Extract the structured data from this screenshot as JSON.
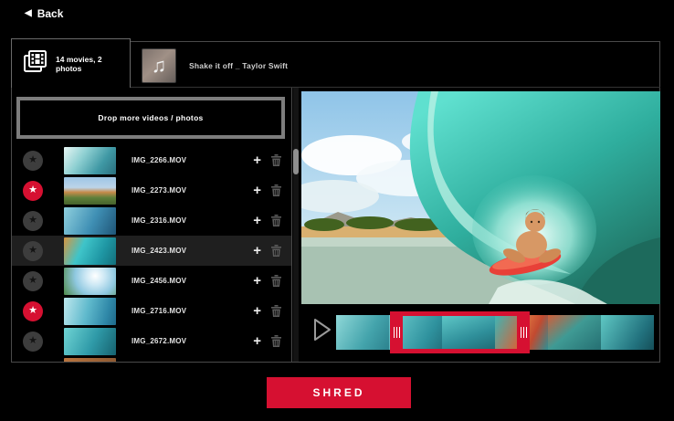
{
  "app": {
    "background": "#000000",
    "accent_red": "#d61031"
  },
  "header": {
    "back_label": "Back",
    "back_icon": "◀"
  },
  "tabs": [
    {
      "id": "media",
      "label": "14 movies, 2 photos",
      "icon": "film-frames-icon",
      "selected": true
    },
    {
      "id": "music",
      "label": "Shake it off _ Taylor Swift",
      "icon": "music-note-icon",
      "music_note_glyph": "♫",
      "selected": false
    }
  ],
  "library": {
    "dropzone_label": "Drop more videos / photos",
    "star_glyph": "★",
    "plus_glyph": "+",
    "clips": [
      {
        "filename": "IMG_2266.MOV",
        "starred": false,
        "selected": false,
        "thumb": "linear-gradient(125deg,#e8f6f4,#8fd0d2 35%,#3f98a4 70%,#2a6f7e)"
      },
      {
        "filename": "IMG_2273.MOV",
        "starred": true,
        "selected": false,
        "thumb": "linear-gradient(180deg,#9ec6e6 0%,#bcd4e8 38%,#c78b4a 55%,#5e7f3a 75%,#46632c 100%)"
      },
      {
        "filename": "IMG_2316.MOV",
        "starred": false,
        "selected": false,
        "thumb": "linear-gradient(115deg,#8fd0de,#3f8fb4 55%,#1f5577)"
      },
      {
        "filename": "IMG_2423.MOV",
        "starred": false,
        "selected": true,
        "thumb": "linear-gradient(115deg,#d79540 0%,#3fc4c9 35%,#1f97a4 70%,#13707c 100%)"
      },
      {
        "filename": "IMG_2456.MOV",
        "starred": false,
        "selected": false,
        "thumb": "radial-gradient(circle at 60% 30%, #ffffff 0%, #cfe9f5 25%, #8fc8e0 55%, #4f8a4a 100%)"
      },
      {
        "filename": "IMG_2716.MOV",
        "starred": true,
        "selected": false,
        "thumb": "linear-gradient(105deg,#bfe8ee,#5fb9cc 45%,#2f88a8 80%,#1f6a8a)"
      },
      {
        "filename": "IMG_2672.MOV",
        "starred": false,
        "selected": false,
        "thumb": "linear-gradient(115deg,#6fd4d4,#2f9aa8 55%,#16626f)"
      },
      {
        "filename": "",
        "starred": false,
        "selected": false,
        "thumb": "linear-gradient(90deg,#b8743f,#8f5a32)"
      }
    ]
  },
  "preview": {
    "content": "surfer-on-bodyboard-in-barrel-wave"
  },
  "timeline": {
    "play_icon": "play-triangle-icon",
    "frames": [
      "linear-gradient(120deg,#8fd8d8,#44a4ac 60%,#2c828e)",
      "linear-gradient(120deg,#6fced0,#2f929e 70%,#23727e)",
      "linear-gradient(160deg,#5fc8c8 0%,#2f8f9a 60%,#1f6a74 100%)",
      "linear-gradient(115deg,#3fb4b4 0%,#d4643a 55%,#c24a30 70%,#2f8f94 100%)",
      "linear-gradient(140deg,#cf5f3a 0%,#3f9a94 45%,#256f72 100%)",
      "linear-gradient(120deg,#5fc8c4,#22727e 70%,#154e58)"
    ],
    "selection": {
      "covers_frames": "2-4"
    }
  },
  "footer": {
    "shred_label": "SHRED"
  }
}
